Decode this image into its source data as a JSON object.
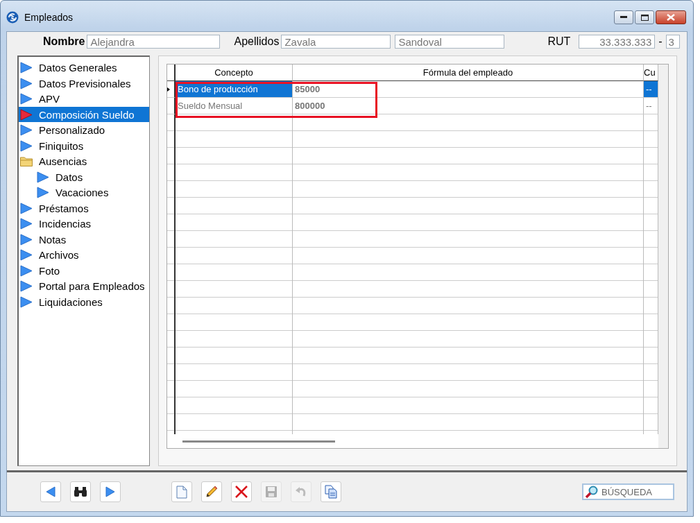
{
  "window": {
    "title": "Empleados"
  },
  "header": {
    "nombre_label": "Nombre",
    "nombre": "Alejandra",
    "apellidos_label": "Apellidos",
    "apellido_1": "Zavala",
    "apellido_2": "Sandoval",
    "rut_label": "RUT",
    "rut": "33.333.333",
    "rut_separator": "-",
    "rut_dv": "3"
  },
  "tree": [
    {
      "label": "Datos Generales",
      "kind": "page",
      "selected": false
    },
    {
      "label": "Datos Previsionales",
      "kind": "page",
      "selected": false
    },
    {
      "label": "APV",
      "kind": "page",
      "selected": false
    },
    {
      "label": "Composición Sueldo",
      "kind": "page",
      "selected": true
    },
    {
      "label": "Personalizado",
      "kind": "page",
      "selected": false
    },
    {
      "label": "Finiquitos",
      "kind": "page",
      "selected": false
    },
    {
      "label": "Ausencias",
      "kind": "folder",
      "selected": false,
      "children": [
        {
          "label": "Datos",
          "kind": "page",
          "selected": false
        },
        {
          "label": "Vacaciones",
          "kind": "page",
          "selected": false
        }
      ]
    },
    {
      "label": "Préstamos",
      "kind": "page",
      "selected": false
    },
    {
      "label": "Incidencias",
      "kind": "page",
      "selected": false
    },
    {
      "label": "Notas",
      "kind": "page",
      "selected": false
    },
    {
      "label": "Archivos",
      "kind": "page",
      "selected": false
    },
    {
      "label": "Foto",
      "kind": "page",
      "selected": false
    },
    {
      "label": "Portal para Empleados",
      "kind": "page",
      "selected": false
    },
    {
      "label": "Liquidaciones",
      "kind": "page",
      "selected": false
    }
  ],
  "table": {
    "columns": [
      "Concepto",
      "Fórmula del empleado",
      "Cu"
    ],
    "rows": [
      {
        "concepto": "Bono de producción",
        "formula": "85000",
        "column_3": "--",
        "selected": true
      },
      {
        "concepto": "Sueldo Mensual",
        "formula": "800000",
        "column_3": "--",
        "selected": false
      }
    ]
  },
  "toolbar": [
    {
      "kind": "prev",
      "disabled": false
    },
    {
      "kind": "find",
      "disabled": false
    },
    {
      "kind": "next",
      "disabled": false
    },
    {
      "kind": "gap"
    },
    {
      "kind": "new",
      "disabled": false
    },
    {
      "kind": "edit",
      "disabled": false
    },
    {
      "kind": "delete",
      "disabled": false
    },
    {
      "kind": "save",
      "disabled": true
    },
    {
      "kind": "undo",
      "disabled": true
    },
    {
      "kind": "copy",
      "disabled": false
    }
  ],
  "search": {
    "placeholder": "BÚSQUEDA"
  }
}
